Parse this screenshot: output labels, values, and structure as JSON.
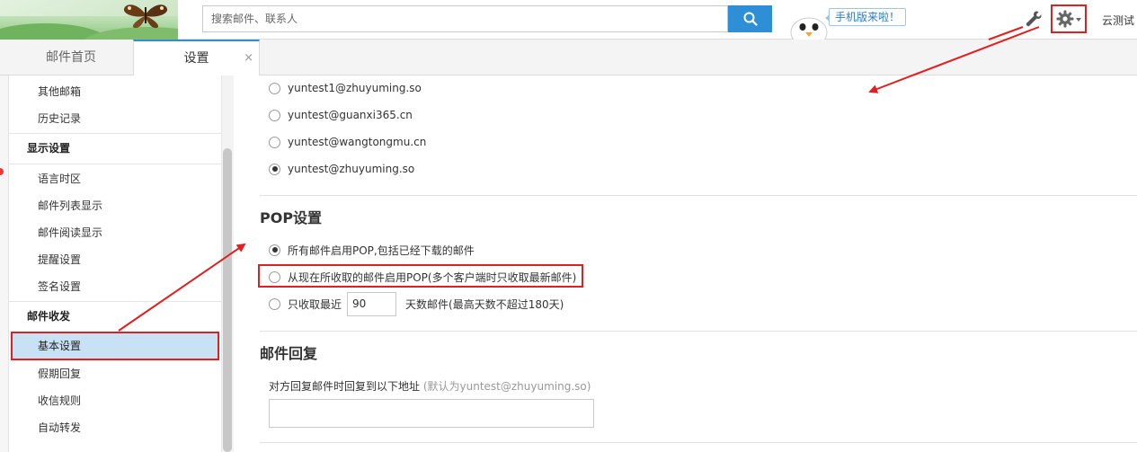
{
  "header": {
    "search_placeholder": "搜索邮件、联系人",
    "mobile_badge": "手机版来啦！",
    "user_name": "云测试"
  },
  "tabs": [
    {
      "label": "邮件首页"
    },
    {
      "label": "设置",
      "close": "×"
    }
  ],
  "sidebar": {
    "items": [
      {
        "label": "其他邮箱"
      },
      {
        "label": "历史记录"
      }
    ],
    "display_section": "显示设置",
    "display_items": [
      {
        "label": "语言时区"
      },
      {
        "label": "邮件列表显示"
      },
      {
        "label": "邮件阅读显示"
      },
      {
        "label": "提醒设置"
      },
      {
        "label": "签名设置"
      }
    ],
    "mail_section": "邮件收发",
    "mail_items": [
      {
        "label": "基本设置"
      },
      {
        "label": "假期回复"
      },
      {
        "label": "收信规则"
      },
      {
        "label": "自动转发"
      }
    ]
  },
  "content": {
    "accounts": [
      {
        "label": "yuntest1@zhuyuming.so",
        "checked": false
      },
      {
        "label": "yuntest@guanxi365.cn",
        "checked": false
      },
      {
        "label": "yuntest@wangtongmu.cn",
        "checked": false
      },
      {
        "label": "yuntest@zhuyuming.so",
        "checked": true
      }
    ],
    "pop_title": "POP设置",
    "pop_option1": "所有邮件启用POP,包括已经下载的邮件",
    "pop_option2": "从现在所收取的邮件启用POP(多个客户端时只收取最新邮件)",
    "pop_option3_prefix": "只收取最近",
    "pop_days": "90",
    "pop_option3_suffix": "天数邮件(最高天数不超过180天)",
    "reply_title": "邮件回复",
    "reply_label": "对方回复邮件时回复到以下地址",
    "reply_hint": "(默认为yuntest@zhuyuming.so)"
  },
  "colors": {
    "accent": "#2f8fd6",
    "highlight_border": "#e02020",
    "active_bg": "#c9e1f4"
  }
}
